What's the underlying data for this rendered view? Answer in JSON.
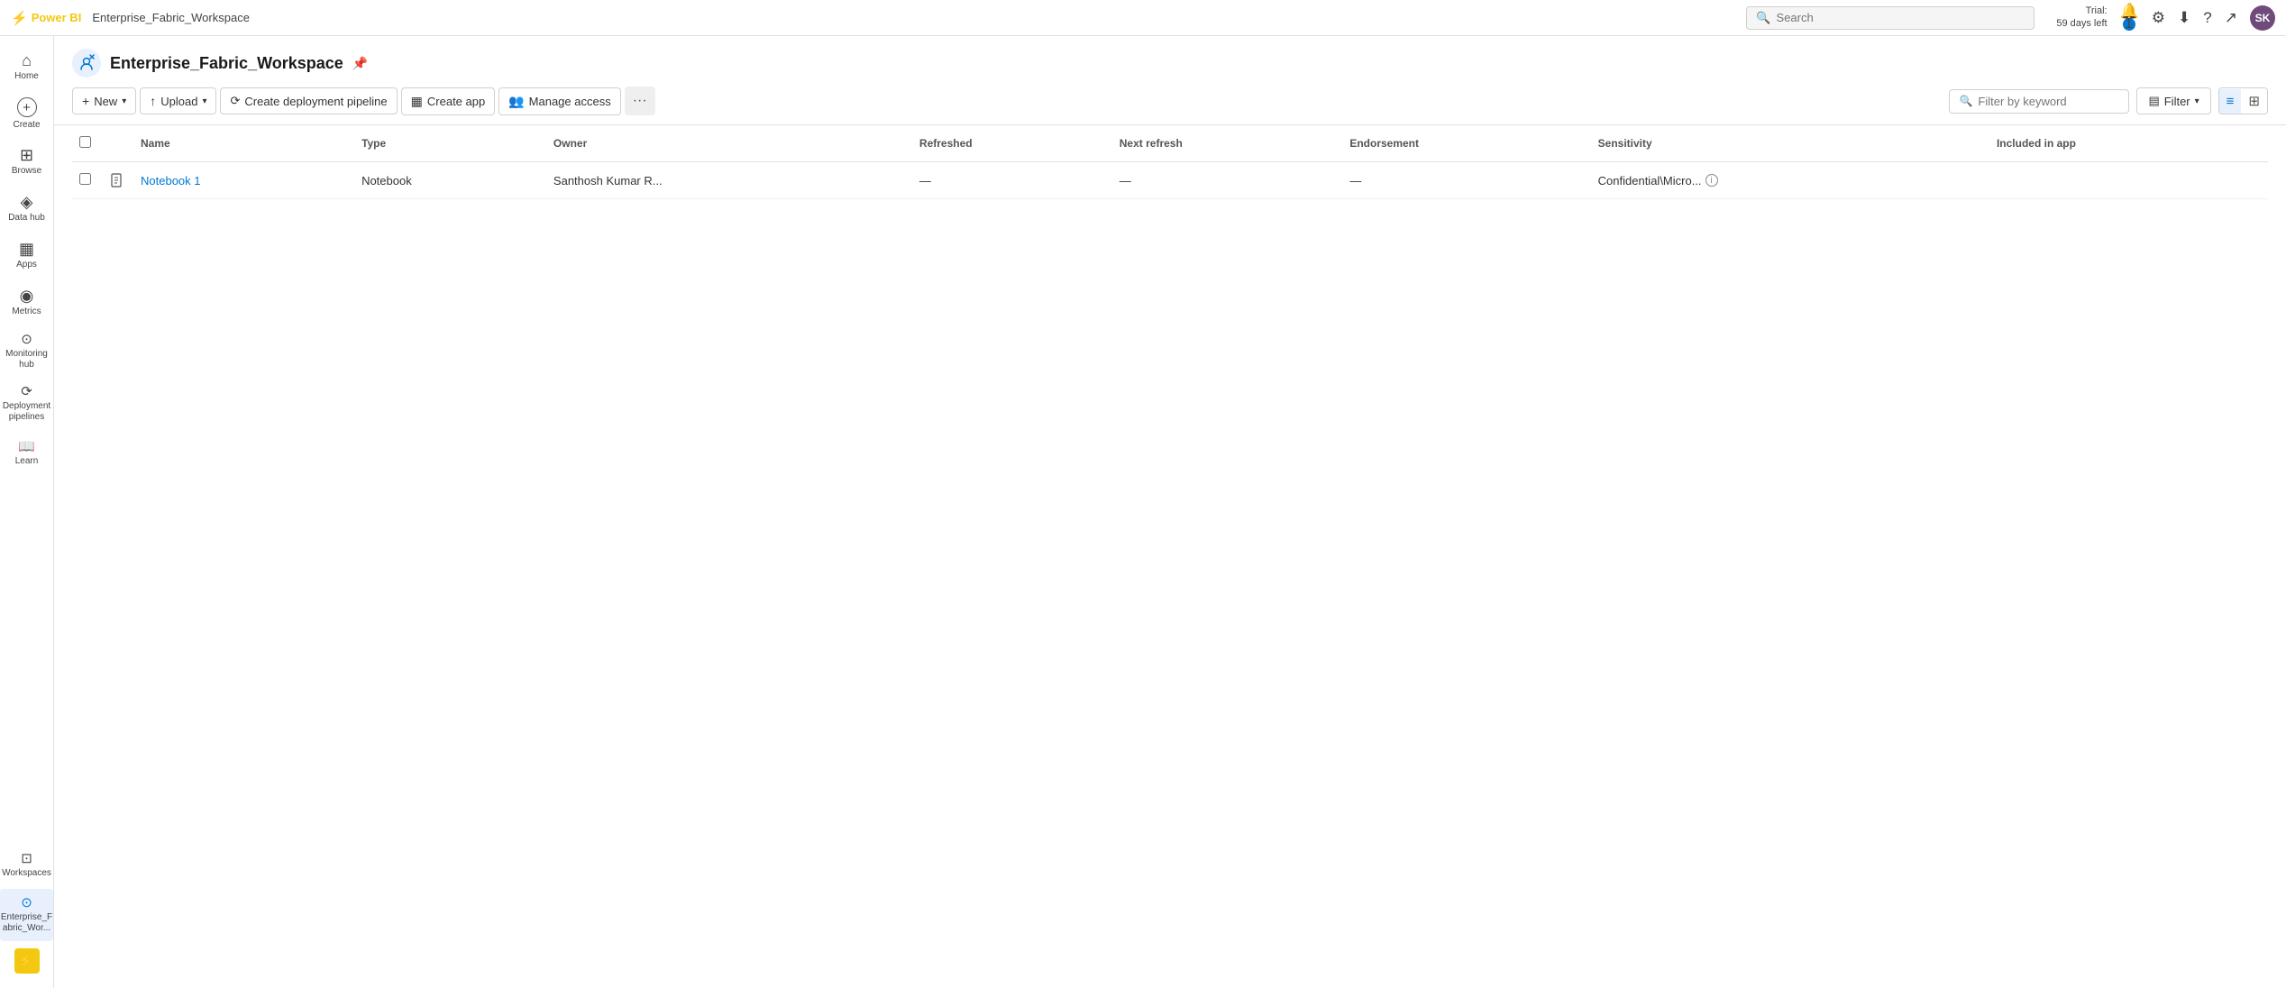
{
  "topbar": {
    "logo": "Power BI",
    "workspace_name": "Enterprise_Fabric_Workspace",
    "search_placeholder": "Search",
    "trial_label": "Trial:",
    "trial_days": "59 days left",
    "notification_count": "1",
    "avatar_initials": "SK"
  },
  "sidebar": {
    "items": [
      {
        "id": "home",
        "icon": "⌂",
        "label": "Home"
      },
      {
        "id": "create",
        "icon": "+",
        "label": "Create"
      },
      {
        "id": "browse",
        "icon": "⊞",
        "label": "Browse"
      },
      {
        "id": "datahub",
        "icon": "◈",
        "label": "Data hub"
      },
      {
        "id": "apps",
        "icon": "▦",
        "label": "Apps"
      },
      {
        "id": "metrics",
        "icon": "⊙",
        "label": "Metrics"
      },
      {
        "id": "monitoring",
        "icon": "◎",
        "label": "Monitoring hub"
      },
      {
        "id": "deployment",
        "icon": "⟳",
        "label": "Deployment pipelines"
      },
      {
        "id": "learn",
        "icon": "📖",
        "label": "Learn"
      },
      {
        "id": "workspaces",
        "icon": "⊡",
        "label": "Workspaces"
      },
      {
        "id": "enterprise_workspace",
        "icon": "⊙",
        "label": "Enterprise_F abric_Wor..."
      }
    ],
    "bottom_icon": "⚡"
  },
  "workspace": {
    "title": "Enterprise_Fabric_Workspace",
    "pin_tooltip": "Pin"
  },
  "toolbar": {
    "new_label": "New",
    "upload_label": "Upload",
    "create_pipeline_label": "Create deployment pipeline",
    "create_app_label": "Create app",
    "manage_access_label": "Manage access",
    "more_label": "···",
    "filter_placeholder": "Filter by keyword",
    "filter_label": "Filter",
    "view_list_label": "≡",
    "view_grid_label": "⊞"
  },
  "table": {
    "columns": [
      {
        "id": "name",
        "label": "Name"
      },
      {
        "id": "type",
        "label": "Type"
      },
      {
        "id": "owner",
        "label": "Owner"
      },
      {
        "id": "refreshed",
        "label": "Refreshed"
      },
      {
        "id": "next_refresh",
        "label": "Next refresh"
      },
      {
        "id": "endorsement",
        "label": "Endorsement"
      },
      {
        "id": "sensitivity",
        "label": "Sensitivity"
      },
      {
        "id": "included_in_app",
        "label": "Included in app"
      }
    ],
    "rows": [
      {
        "icon": "📓",
        "name": "Notebook 1",
        "type": "Notebook",
        "owner": "Santhosh Kumar R...",
        "refreshed": "—",
        "next_refresh": "—",
        "endorsement": "—",
        "sensitivity": "Confidential\\Micro...",
        "included_in_app": ""
      }
    ]
  }
}
